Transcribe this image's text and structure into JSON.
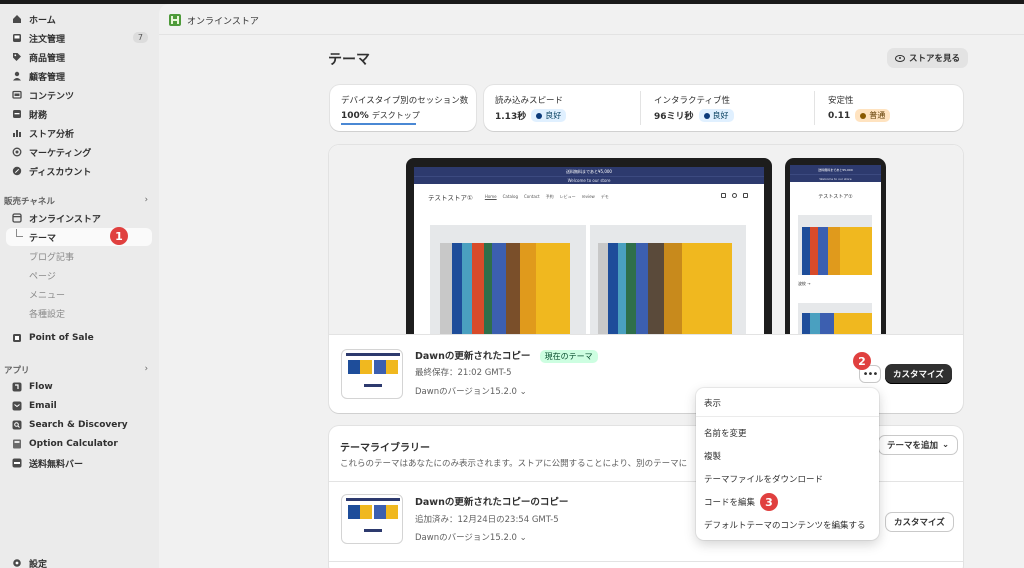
{
  "sidebar": {
    "nav": [
      {
        "label": "ホーム",
        "icon": "home-icon"
      },
      {
        "label": "注文管理",
        "icon": "inbox-icon",
        "count": "7"
      },
      {
        "label": "商品管理",
        "icon": "tag-icon"
      },
      {
        "label": "顧客管理",
        "icon": "person-icon"
      },
      {
        "label": "コンテンツ",
        "icon": "content-icon"
      },
      {
        "label": "財務",
        "icon": "finance-icon"
      },
      {
        "label": "ストア分析",
        "icon": "bar-chart-icon"
      },
      {
        "label": "マーケティング",
        "icon": "target-icon"
      },
      {
        "label": "ディスカウント",
        "icon": "discount-icon"
      }
    ],
    "sales_channels_header": "販売チャネル",
    "online_store": {
      "label": "オンラインストア",
      "subitems": [
        "テーマ",
        "ブログ記事",
        "ページ",
        "メニュー",
        "各種設定"
      ]
    },
    "pos_label": "Point of Sale",
    "apps_header": "アプリ",
    "apps": [
      {
        "label": "Flow",
        "icon": "flow-icon"
      },
      {
        "label": "Email",
        "icon": "email-icon"
      },
      {
        "label": "Search & Discovery",
        "icon": "search-icon"
      },
      {
        "label": "Option Calculator",
        "icon": "calculator-icon"
      },
      {
        "label": "送料無料バー",
        "icon": "app-icon"
      }
    ],
    "settings_label": "設定"
  },
  "steps": {
    "one": "1",
    "two": "2",
    "three": "3"
  },
  "header": {
    "store_name": "オンラインストア"
  },
  "page": {
    "title": "テーマ",
    "view_store": "ストアを見る"
  },
  "metrics": [
    {
      "label": "デバイスタイプ別のセッション数",
      "value": "100%",
      "value_sub": "デスクトップ"
    },
    {
      "label": "読み込みスピード",
      "value": "1.13秒",
      "status": "良好"
    },
    {
      "label": "インタラクティブ性",
      "value": "96ミリ秒",
      "status": "良好"
    },
    {
      "label": "安定性",
      "value": "0.11",
      "status": "普通"
    }
  ],
  "preview": {
    "announcement": "送料無料まであと¥5,000",
    "welcome": "Welcome to our store",
    "store_title": "テストストア①",
    "nav_links": [
      "Home",
      "Catalog",
      "Contact",
      "予約",
      "レビュー",
      "review",
      "デモ"
    ],
    "phone_title": "テストストア①",
    "phone_caption": "波紋 →"
  },
  "current_theme": {
    "name": "Dawnの更新されたコピー",
    "status": "現在のテーマ",
    "saved": "最終保存：21:02 GMT-5",
    "version": "Dawnのバージョン15.2.0",
    "more": "•••",
    "customize": "カスタマイズ"
  },
  "library": {
    "title": "テーマライブラリー",
    "desc": "これらのテーマはあなたにのみ表示されます。ストアに公開することにより、別のテーマに",
    "add_button": "テーマを追加",
    "theme": {
      "name": "Dawnの更新されたコピーのコピー",
      "added": "追加済み：12月24日の23:54 GMT-5",
      "version": "Dawnのバージョン15.2.0",
      "customize": "カスタマイズ"
    }
  },
  "menu": {
    "items": [
      "表示",
      "名前を変更",
      "複製",
      "テーマファイルをダウンロード",
      "コードを編集",
      "デフォルトテーマのコンテンツを編集する"
    ]
  },
  "colors": {
    "badge_red": "#e0403f",
    "primary_dark": "#303030",
    "status_green_bg": "#cdfee1",
    "status_blue_bg": "#e0f0ff",
    "status_orange_bg": "#ffe3c0"
  }
}
